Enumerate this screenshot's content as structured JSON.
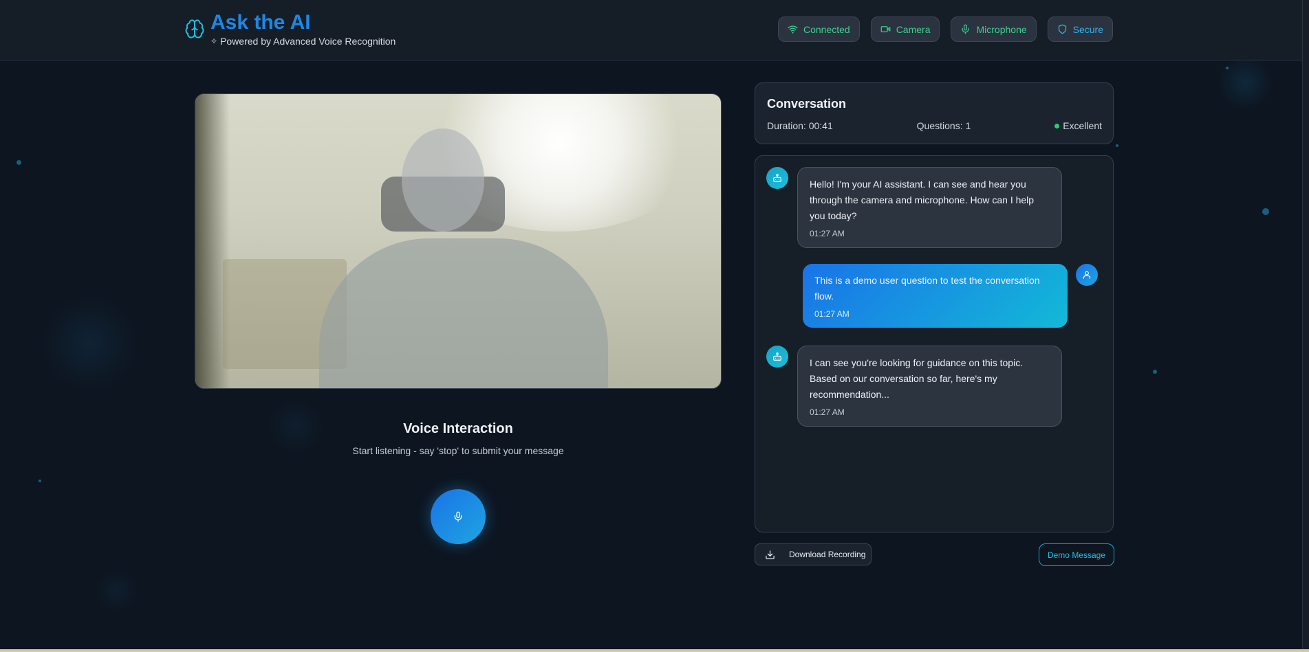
{
  "header": {
    "title": "Ask the AI",
    "subtitle": "Powered by Advanced Voice Recognition",
    "logo_icon": "brain-icon",
    "status_pills": [
      {
        "label": "Connected",
        "icon": "wifi-icon",
        "color": "#3ecf8e"
      },
      {
        "label": "Camera",
        "icon": "video-camera-icon",
        "color": "#3ecf8e"
      },
      {
        "label": "Microphone",
        "icon": "microphone-icon",
        "color": "#3ecf8e"
      },
      {
        "label": "Secure",
        "icon": "shield-icon",
        "color": "#29b6f6"
      }
    ]
  },
  "voice": {
    "title": "Voice Interaction",
    "instruction": "Start listening - say 'stop' to submit your message",
    "button_icon": "microphone-icon"
  },
  "conversation": {
    "title": "Conversation",
    "duration": "Duration: 00:41",
    "questions": "Questions: 1",
    "quality": "Excellent",
    "quality_color": "#2ecc71"
  },
  "messages": [
    {
      "sender": "bot",
      "text": "Hello! I'm your AI assistant. I can see and hear you through the camera and microphone. How can I help you today?",
      "time": "01:27 AM"
    },
    {
      "sender": "user",
      "text": "This is a demo user question to test the conversation flow.",
      "time": "01:27 AM"
    },
    {
      "sender": "bot",
      "text": "I can see you're looking for guidance on this topic. Based on our conversation so far, here's my recommendation...",
      "time": "01:27 AM"
    }
  ],
  "actions": {
    "download_label": "Download Recording",
    "demo_label": "Demo Message"
  },
  "colors": {
    "accent": "#1e88e5",
    "background": "#0d1520",
    "status_green": "#3ecf8e",
    "cyan": "#1ec0e0"
  }
}
